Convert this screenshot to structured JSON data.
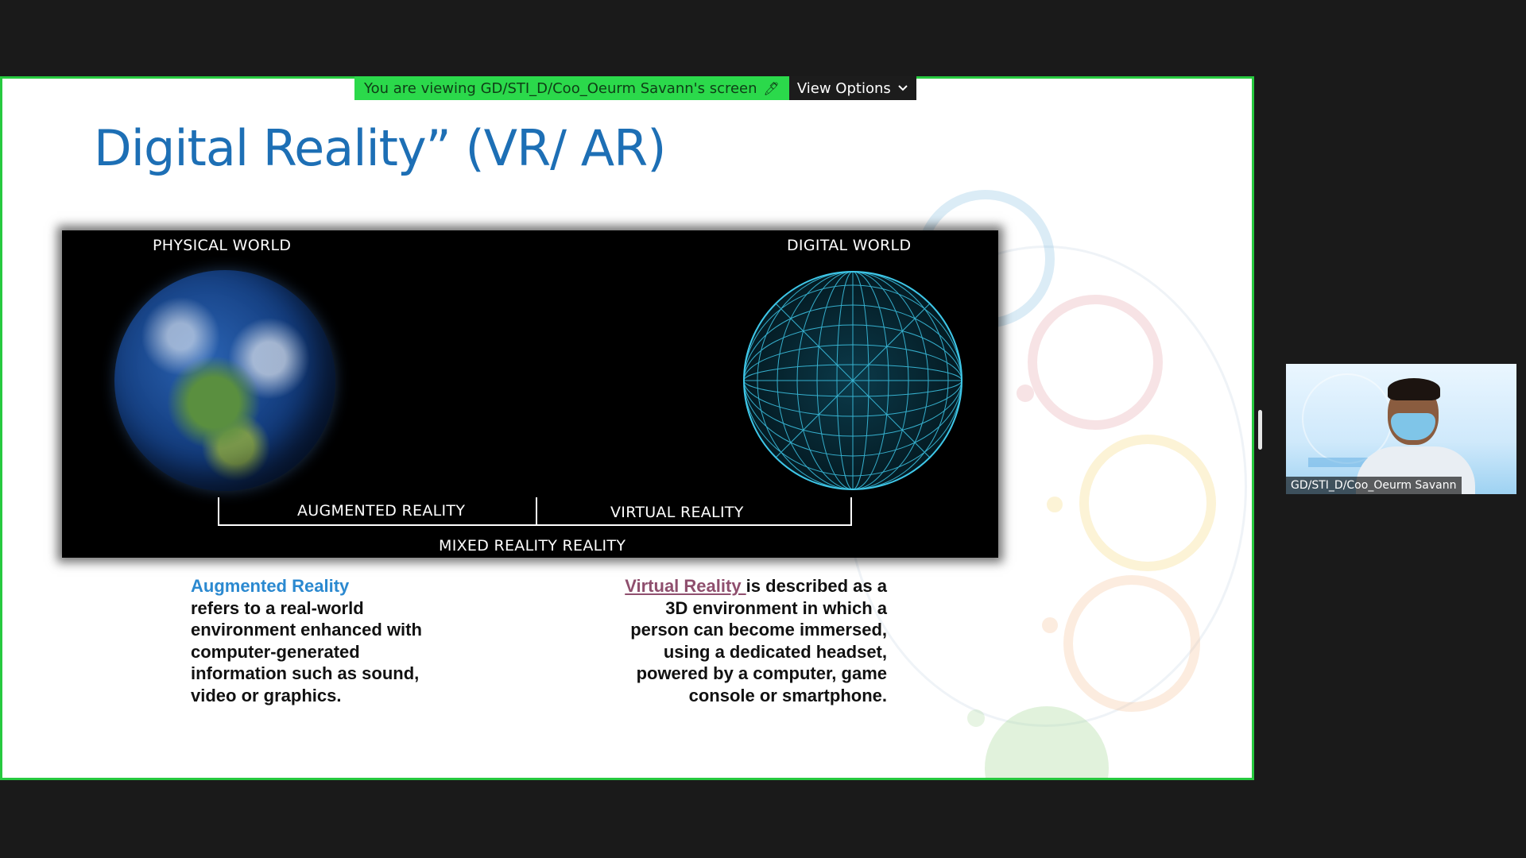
{
  "banner": {
    "viewing_text": "You are viewing GD/STI_D/Coo_Oeurm Savann's screen",
    "view_options_label": "View Options"
  },
  "slide": {
    "title": "Digital Reality” (VR/ AR)",
    "panel": {
      "physical_world": "PHYSICAL WORLD",
      "digital_world": "DIGITAL WORLD",
      "augmented_reality": "AUGMENTED REALITY",
      "virtual_reality": "VIRTUAL REALITY",
      "mixed_reality": "MIXED REALITY REALITY"
    },
    "ar_description": {
      "term": "Augmented Reality",
      "text": "refers to a real-world environment enhanced with computer-generated information such as sound, video or graphics."
    },
    "vr_description": {
      "term": "Virtual Reality ",
      "text": "is described as a 3D environment in which a person can become immersed, using a dedicated headset, powered by a computer, game console or smartphone."
    }
  },
  "participant": {
    "name": "GD/STI_D/Coo_Oeurm Savann"
  },
  "colors": {
    "share_border": "#27c93f",
    "title_blue": "#1d6fb5",
    "ar_blue": "#2b89d0",
    "vr_purple": "#8f4f6e"
  }
}
